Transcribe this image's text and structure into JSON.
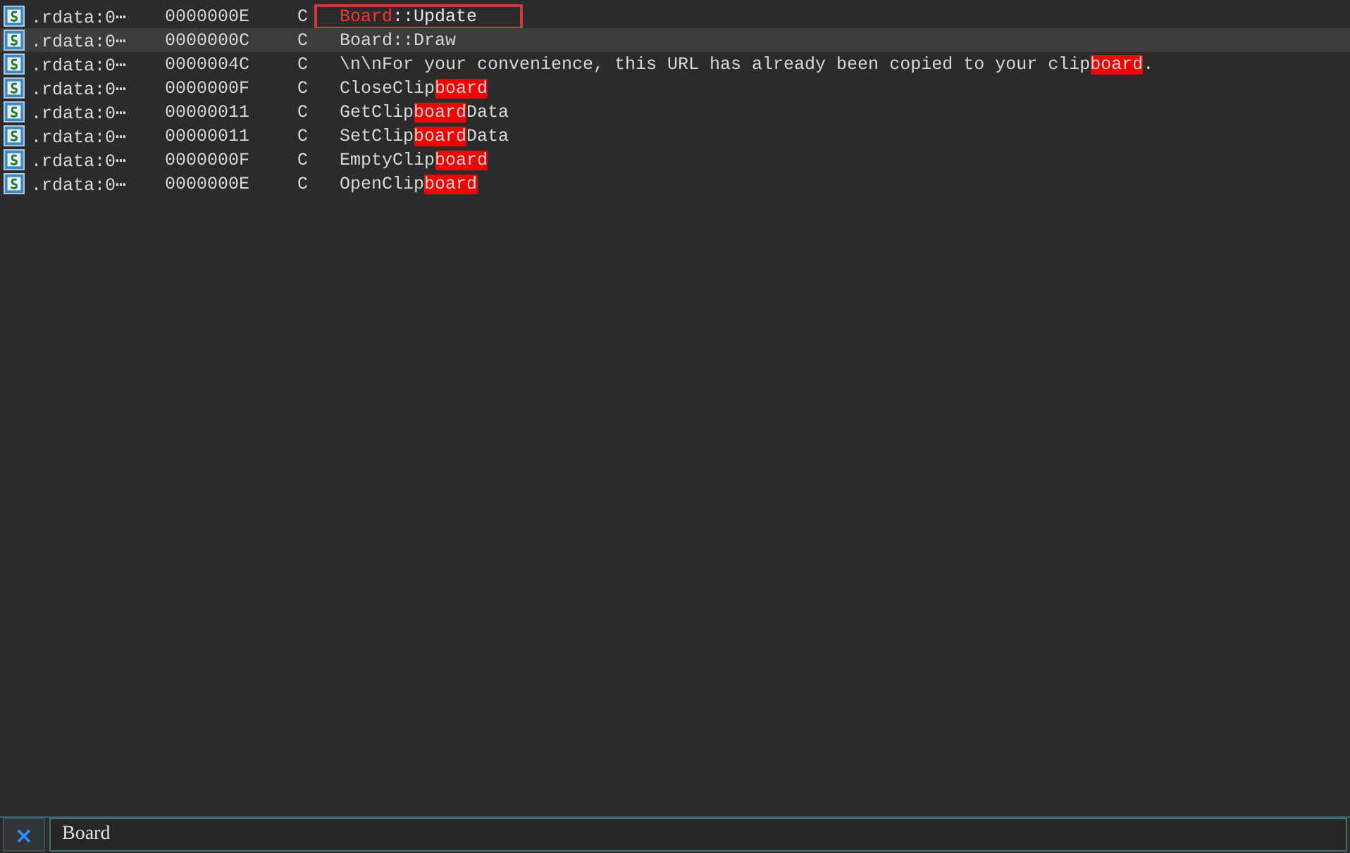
{
  "rows": [
    {
      "address": ".rdata:0⋯",
      "length": "0000000E",
      "type": "C",
      "before": "",
      "match": "Board",
      "after": "::Update",
      "selected": false,
      "current": true,
      "outlined": true
    },
    {
      "address": ".rdata:0⋯",
      "length": "0000000C",
      "type": "C",
      "before": "Board::Draw",
      "match": "",
      "after": "",
      "selected": true,
      "current": false,
      "outlined": false
    },
    {
      "address": ".rdata:0⋯",
      "length": "0000004C",
      "type": "C",
      "before": "\\n\\nFor your convenience, this URL has already been copied to your clip",
      "match": "board",
      "after": ".",
      "selected": false,
      "current": false,
      "outlined": false
    },
    {
      "address": ".rdata:0⋯",
      "length": "0000000F",
      "type": "C",
      "before": "CloseClip",
      "match": "board",
      "after": "",
      "selected": false,
      "current": false,
      "outlined": false
    },
    {
      "address": ".rdata:0⋯",
      "length": "00000011",
      "type": "C",
      "before": "GetClip",
      "match": "board",
      "after": "Data",
      "selected": false,
      "current": false,
      "outlined": false
    },
    {
      "address": ".rdata:0⋯",
      "length": "00000011",
      "type": "C",
      "before": "SetClip",
      "match": "board",
      "after": "Data",
      "selected": false,
      "current": false,
      "outlined": false
    },
    {
      "address": ".rdata:0⋯",
      "length": "0000000F",
      "type": "C",
      "before": "EmptyClip",
      "match": "board",
      "after": "",
      "selected": false,
      "current": false,
      "outlined": false
    },
    {
      "address": ".rdata:0⋯",
      "length": "0000000E",
      "type": "C",
      "before": "OpenClip",
      "match": "board",
      "after": "",
      "selected": false,
      "current": false,
      "outlined": false
    }
  ],
  "search": {
    "close": "×",
    "value": "Board"
  }
}
